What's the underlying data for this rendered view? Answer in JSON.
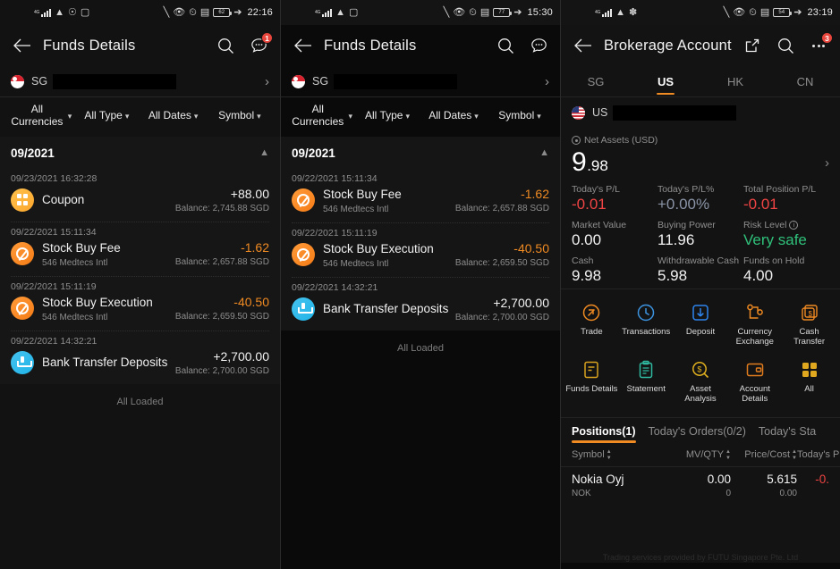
{
  "panel1": {
    "status": {
      "time": "22:16",
      "battery": "62",
      "signal_label": "4G"
    },
    "nav": {
      "title": "Funds Details",
      "search_icon": "search-icon",
      "more_icon": "chat-more-icon",
      "badge": "1"
    },
    "account": {
      "country_code": "SG",
      "masked": ""
    },
    "filters": [
      {
        "label": "All Currencies",
        "two_line": true
      },
      {
        "label": "All Type",
        "two_line": false
      },
      {
        "label": "All Dates",
        "two_line": false
      },
      {
        "label": "Symbol",
        "two_line": false
      }
    ],
    "month": "09/2021",
    "transactions": [
      {
        "date": "09/23/2021 16:32:28",
        "title": "Coupon",
        "sub": "",
        "amount": "+88.00",
        "sign": "pos",
        "balance": "Balance: 2,745.88 SGD",
        "icon": "coupon"
      },
      {
        "date": "09/22/2021 15:11:34",
        "title": "Stock Buy Fee",
        "sub": "546 Medtecs Intl",
        "amount": "-1.62",
        "sign": "neg",
        "balance": "Balance: 2,657.88 SGD",
        "icon": "fee"
      },
      {
        "date": "09/22/2021 15:11:19",
        "title": "Stock Buy Execution",
        "sub": "546 Medtecs Intl",
        "amount": "-40.50",
        "sign": "neg",
        "balance": "Balance: 2,659.50 SGD",
        "icon": "fee"
      },
      {
        "date": "09/22/2021 14:32:21",
        "title": "Bank Transfer Deposits",
        "sub": "",
        "amount": "+2,700.00",
        "sign": "pos",
        "balance": "Balance: 2,700.00 SGD",
        "icon": "dep"
      }
    ],
    "all_loaded": "All Loaded"
  },
  "panel2": {
    "status": {
      "time": "15:30",
      "battery": "77",
      "signal_label": "4G"
    },
    "nav": {
      "title": "Funds Details",
      "search_icon": "search-icon",
      "more_icon": "chat-more-icon",
      "badge": ""
    },
    "account": {
      "country_code": "SG",
      "masked": ""
    },
    "filters": [
      {
        "label": "All Currencies",
        "two_line": true
      },
      {
        "label": "All Type",
        "two_line": false
      },
      {
        "label": "All Dates",
        "two_line": false
      },
      {
        "label": "Symbol",
        "two_line": false
      }
    ],
    "month": "09/2021",
    "transactions": [
      {
        "date": "09/22/2021 15:11:34",
        "title": "Stock Buy Fee",
        "sub": "546 Medtecs Intl",
        "amount": "-1.62",
        "sign": "neg",
        "balance": "Balance: 2,657.88 SGD",
        "icon": "fee"
      },
      {
        "date": "09/22/2021 15:11:19",
        "title": "Stock Buy Execution",
        "sub": "546 Medtecs Intl",
        "amount": "-40.50",
        "sign": "neg",
        "balance": "Balance: 2,659.50 SGD",
        "icon": "fee"
      },
      {
        "date": "09/22/2021 14:32:21",
        "title": "Bank Transfer Deposits",
        "sub": "",
        "amount": "+2,700.00",
        "sign": "pos",
        "balance": "Balance: 2,700.00 SGD",
        "icon": "dep"
      }
    ],
    "all_loaded": "All Loaded"
  },
  "panel3": {
    "status": {
      "time": "23:19",
      "battery": "54",
      "signal_label": "4G"
    },
    "nav": {
      "title": "Brokerage Account",
      "share_icon": "share-icon",
      "search_icon": "search-icon",
      "more_icon": "ellipsis-icon",
      "badge": "3"
    },
    "region_tabs": [
      {
        "label": "SG",
        "active": false
      },
      {
        "label": "US",
        "active": true
      },
      {
        "label": "HK",
        "active": false
      },
      {
        "label": "CN",
        "active": false
      }
    ],
    "account": {
      "country_code": "US",
      "masked": ""
    },
    "net_assets": {
      "label": "Net Assets (USD)",
      "integer": "9",
      "decimal": ".98"
    },
    "metrics": [
      {
        "label": "Today's P/L",
        "value": "-0.01",
        "color": "red",
        "info": false
      },
      {
        "label": "Today's P/L%",
        "value": "+0.00%",
        "color": "bluegray",
        "info": false
      },
      {
        "label": "Total Position P/L",
        "value": "-0.01",
        "color": "red",
        "info": false
      },
      {
        "label": "Market Value",
        "value": "0.00",
        "color": "",
        "info": false
      },
      {
        "label": "Buying Power",
        "value": "11.96",
        "color": "",
        "info": false
      },
      {
        "label": "Risk Level",
        "value": "Very safe",
        "color": "green",
        "info": true
      },
      {
        "label": "Cash",
        "value": "9.98",
        "color": "",
        "info": false
      },
      {
        "label": "Withdrawable Cash",
        "value": "5.98",
        "color": "",
        "info": false
      },
      {
        "label": "Funds on Hold",
        "value": "4.00",
        "color": "",
        "info": false
      }
    ],
    "actions": [
      {
        "label": "Trade",
        "icon": "trade-icon",
        "color": "#f08a22"
      },
      {
        "label": "Transactions",
        "icon": "clock-icon",
        "color": "#3c93e0"
      },
      {
        "label": "Deposit",
        "icon": "download-arrow-icon",
        "color": "#2e86f0"
      },
      {
        "label": "Currency Exchange",
        "icon": "currency-exchange-icon",
        "color": "#f08a22"
      },
      {
        "label": "Cash Transfer",
        "icon": "cash-transfer-icon",
        "color": "#f08a22"
      },
      {
        "label": "Funds Details",
        "icon": "funds-details-icon",
        "color": "#d8a11e"
      },
      {
        "label": "Statement",
        "icon": "statement-icon",
        "color": "#2fb9a0"
      },
      {
        "label": "Asset Analysis",
        "icon": "asset-analysis-icon",
        "color": "#e0b01e"
      },
      {
        "label": "Account Details",
        "icon": "wallet-icon",
        "color": "#e07c1e"
      },
      {
        "label": "All",
        "icon": "grid-icon",
        "color": "#e0a81e"
      }
    ],
    "position_tabs": [
      {
        "label": "Positions(1)",
        "active": true
      },
      {
        "label": "Today's Orders(0/2)",
        "active": false
      },
      {
        "label": "Today's Sta",
        "active": false
      }
    ],
    "position_columns": [
      {
        "label": "Symbol",
        "sortable": true
      },
      {
        "label": "MV/QTY",
        "sortable": true
      },
      {
        "label": "Price/Cost",
        "sortable": true
      },
      {
        "label": "Today's P",
        "sortable": false
      }
    ],
    "positions": [
      {
        "name": "Nokia Oyj",
        "symbol": "NOK",
        "mv": "0.00",
        "qty": "0",
        "price": "5.615",
        "cost": "0.00",
        "today_pl": "-0."
      }
    ],
    "footer_note": "Trading services provided by FUTU Singapore Pte. Ltd"
  }
}
